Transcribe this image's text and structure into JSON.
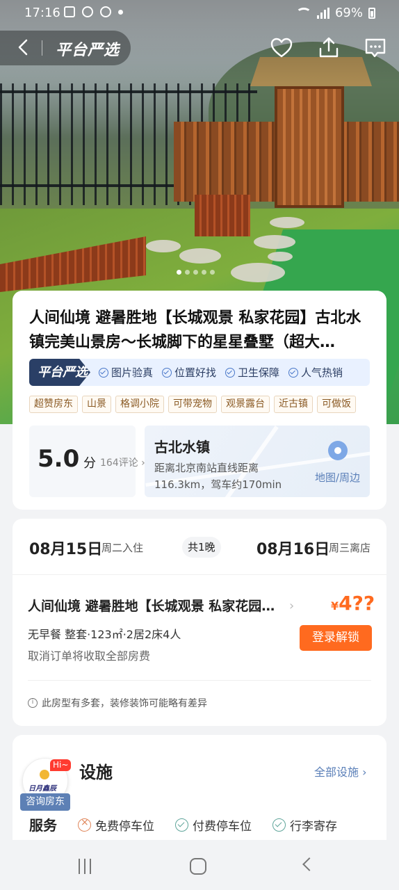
{
  "status_bar": {
    "time": "17:16",
    "battery": "69%"
  },
  "nav": {
    "brand": "平台严选"
  },
  "gallery": {
    "dots": 5,
    "active_dot": 1
  },
  "listing": {
    "title": "人间仙境 避暑胜地【长城观景 私家花园】古北水镇完美山景房～长城脚下的星星叠墅（超大…",
    "assurance_badge": "平台严选",
    "assurances": [
      "图片验真",
      "位置好找",
      "卫生保障",
      "人气热销"
    ],
    "tags": [
      "超赞房东",
      "山景",
      "格调小院",
      "可带宠物",
      "观景露台",
      "近古镇",
      "可做饭"
    ],
    "score": "5.0",
    "score_unit": "分",
    "reviews": "164评论",
    "town": "古北水镇",
    "distance_line1": "距离北京南站直线距离",
    "distance_line2": "116.3km，驾车约170min",
    "map_link": "地图/周边"
  },
  "booking": {
    "checkin_date": "08月15日",
    "checkin_label": "周二入住",
    "nights": "共1晚",
    "checkout_date": "08月16日",
    "checkout_label": "周三离店",
    "room_title": "人间仙境 避暑胜地【长城观景 私家花园…",
    "price_symbol": "¥",
    "price": "4??",
    "room_desc": "无早餐 整套·123㎡·2居2床4人",
    "cancel_policy": "取消订单将收取全部房费",
    "login_button": "登录解锁",
    "note": "此房型有多套，装修装饰可能略有差异"
  },
  "facilities": {
    "title": "设施",
    "all_link": "全部设施",
    "service_label": "服务",
    "services": [
      {
        "label": "免费停车位",
        "icon": "x-circle-icon"
      },
      {
        "label": "付费停车位",
        "icon": "check-circle-icon"
      },
      {
        "label": "行李寄存",
        "icon": "check-circle-icon"
      }
    ]
  },
  "host": {
    "greeting": "Hi~",
    "label": "咨询房东",
    "logo_text": "日月鑫辰"
  },
  "colors": {
    "accent": "#ff6a1f",
    "link": "#5a7fb8",
    "badge": "#2a3f66"
  }
}
